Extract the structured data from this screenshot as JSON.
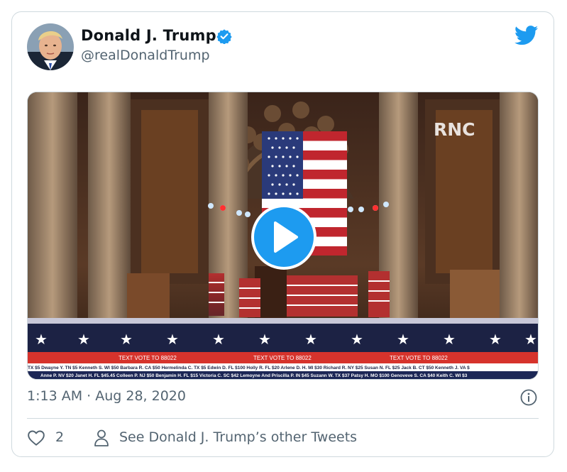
{
  "tweet": {
    "author_name": "Donald J. Trump",
    "author_handle": "@realDonaldTrump",
    "timestamp": "1:13 AM · Aug 28, 2020",
    "like_count": "2",
    "other_tweets_label": "See Donald J. Trump’s other Tweets"
  },
  "media": {
    "watermark": "RNC",
    "ticker_banner": [
      "TEXT VOTE TO 88022",
      "TEXT VOTE TO 88022",
      "TEXT VOTE TO 88022"
    ],
    "ticker_row1": "TX $5   Dwayne Y. TN $5   Kenneth S. WI $50   Barbara R. CA $50   Hermelinda C. TX $5   Edwin D. FL $100   Holly R. FL $20   Arlene D. H. MI $30   Richard R. NY $25   Susan N. FL $25   Jack B. CT $50   Kenneth J. VA $",
    "ticker_row2": "Anne P. NV $20   Janet H. FL $45.45   Colleen P. NJ $50   Benjamin H. FL $15   Victoria C. SC $42   Lemoyne And Priscilla P. IN $45   Suzann W. TX $37   Patsy H. MO $100   Genoveve S. CA $40   Keith C. WI $3"
  },
  "icons": {
    "verified": "verified-badge-icon",
    "twitter": "twitter-bird-icon",
    "play": "play-icon",
    "info": "info-icon",
    "like": "heart-icon",
    "profile": "person-icon"
  },
  "colors": {
    "accent": "#1d9bf0",
    "secondary_text": "#536471",
    "border": "#cfd9de"
  }
}
